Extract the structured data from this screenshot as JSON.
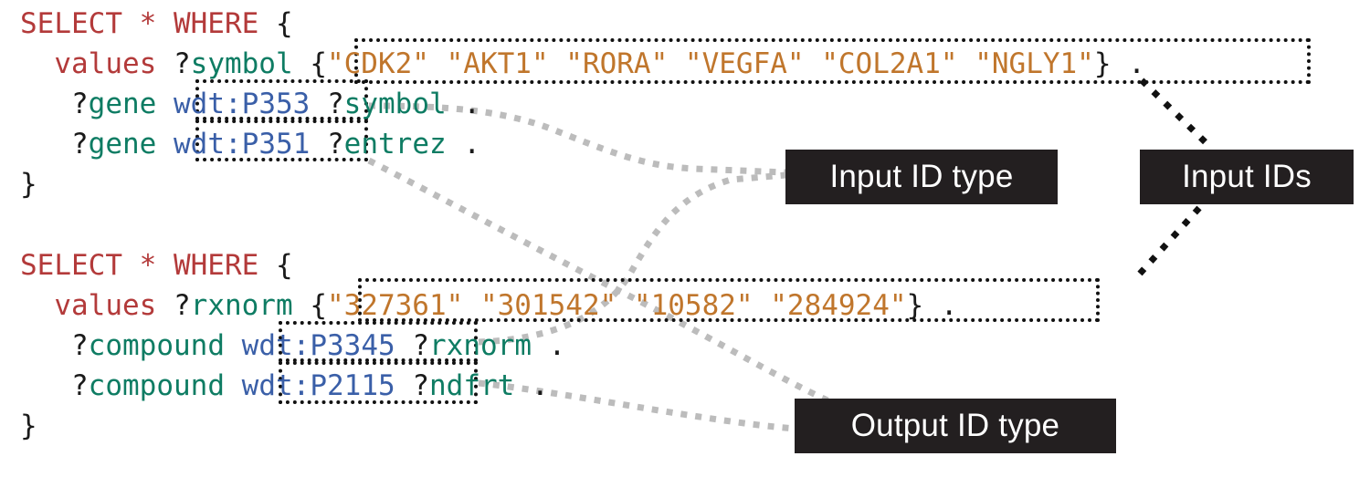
{
  "figure": {
    "title": "SPARQL query annotation diagram",
    "background_color": "#ffffff",
    "syntax_colors": {
      "keyword": "#b33a3a",
      "variable": "#0e7c63",
      "predicate": "#3a5fa8",
      "string": "#c0762c",
      "punctuation": "#1a1a1a",
      "label_background": "#231f20",
      "label_text": "#ffffff",
      "highlight_border": "#111111",
      "connector_gray": "#b8b8b8",
      "connector_black": "#111111"
    }
  },
  "queries": [
    {
      "id": "gene-query",
      "lines": [
        {
          "id": "q1l1",
          "tokens": [
            {
              "t": "SELECT * WHERE ",
              "c": "kw"
            },
            {
              "t": "{",
              "c": "pun"
            }
          ]
        },
        {
          "id": "q1l2",
          "tokens": [
            {
              "t": "  values ",
              "c": "kw"
            },
            {
              "t": "?",
              "c": "pun"
            },
            {
              "t": "symbol",
              "c": "var"
            },
            {
              "t": " ",
              "c": "pun"
            },
            {
              "t": "{",
              "c": "pun"
            },
            {
              "t": "\"CDK2\" \"AKT1\" \"RORA\" \"VEGFA\" \"COL2A1\" \"NGLY1\"",
              "c": "str"
            },
            {
              "t": "}",
              "c": "pun"
            },
            {
              "t": " .",
              "c": "pun"
            }
          ]
        },
        {
          "id": "q1l3",
          "tokens": [
            {
              "t": "   ",
              "c": "pun"
            },
            {
              "t": "?",
              "c": "pun"
            },
            {
              "t": "gene",
              "c": "var"
            },
            {
              "t": " ",
              "c": "pun"
            },
            {
              "t": "wdt",
              "c": "pred"
            },
            {
              "t": ":",
              "c": "pred"
            },
            {
              "t": "P353",
              "c": "pred"
            },
            {
              "t": " ",
              "c": "pun"
            },
            {
              "t": "?",
              "c": "pun"
            },
            {
              "t": "symbol",
              "c": "var"
            },
            {
              "t": " .",
              "c": "pun"
            }
          ]
        },
        {
          "id": "q1l4",
          "tokens": [
            {
              "t": "   ",
              "c": "pun"
            },
            {
              "t": "?",
              "c": "pun"
            },
            {
              "t": "gene",
              "c": "var"
            },
            {
              "t": " ",
              "c": "pun"
            },
            {
              "t": "wdt",
              "c": "pred"
            },
            {
              "t": ":",
              "c": "pred"
            },
            {
              "t": "P351",
              "c": "pred"
            },
            {
              "t": " ",
              "c": "pun"
            },
            {
              "t": "?",
              "c": "pun"
            },
            {
              "t": "entrez",
              "c": "var"
            },
            {
              "t": " .",
              "c": "pun"
            }
          ]
        },
        {
          "id": "q1l5",
          "tokens": [
            {
              "t": "}",
              "c": "pun"
            }
          ]
        }
      ]
    },
    {
      "id": "compound-query",
      "lines": [
        {
          "id": "q2l1",
          "tokens": [
            {
              "t": "SELECT * WHERE ",
              "c": "kw"
            },
            {
              "t": "{",
              "c": "pun"
            }
          ]
        },
        {
          "id": "q2l2",
          "tokens": [
            {
              "t": "  values ",
              "c": "kw"
            },
            {
              "t": "?",
              "c": "pun"
            },
            {
              "t": "rxnorm",
              "c": "var"
            },
            {
              "t": " ",
              "c": "pun"
            },
            {
              "t": "{",
              "c": "pun"
            },
            {
              "t": "\"327361\" \"301542\" \"10582\" \"284924\"",
              "c": "str"
            },
            {
              "t": "}",
              "c": "pun"
            },
            {
              "t": " .",
              "c": "pun"
            }
          ]
        },
        {
          "id": "q2l3",
          "tokens": [
            {
              "t": "   ",
              "c": "pun"
            },
            {
              "t": "?",
              "c": "pun"
            },
            {
              "t": "compound",
              "c": "var"
            },
            {
              "t": " ",
              "c": "pun"
            },
            {
              "t": "wdt",
              "c": "pred"
            },
            {
              "t": ":",
              "c": "pred"
            },
            {
              "t": "P3345",
              "c": "pred"
            },
            {
              "t": " ",
              "c": "pun"
            },
            {
              "t": "?",
              "c": "pun"
            },
            {
              "t": "rxnorm",
              "c": "var"
            },
            {
              "t": " .",
              "c": "pun"
            }
          ]
        },
        {
          "id": "q2l4",
          "tokens": [
            {
              "t": "   ",
              "c": "pun"
            },
            {
              "t": "?",
              "c": "pun"
            },
            {
              "t": "compound",
              "c": "var"
            },
            {
              "t": " ",
              "c": "pun"
            },
            {
              "t": "wdt",
              "c": "pred"
            },
            {
              "t": ":",
              "c": "pred"
            },
            {
              "t": "P2115",
              "c": "pred"
            },
            {
              "t": " ",
              "c": "pun"
            },
            {
              "t": "?",
              "c": "pun"
            },
            {
              "t": "ndfrt",
              "c": "var"
            },
            {
              "t": " .",
              "c": "pun"
            }
          ]
        },
        {
          "id": "q2l5",
          "tokens": [
            {
              "t": "}",
              "c": "pun"
            }
          ]
        }
      ]
    }
  ],
  "annotations": {
    "input_id_type": "Input ID type",
    "input_ids": "Input IDs",
    "output_id_type": "Output ID type"
  },
  "highlights": [
    {
      "name": "values-ids-gene",
      "label": "Input IDs"
    },
    {
      "name": "wdt-p353",
      "label": "Input ID type"
    },
    {
      "name": "wdt-p351",
      "label": "Output ID type"
    },
    {
      "name": "values-ids-compound",
      "label": "Input IDs"
    },
    {
      "name": "wdt-p3345",
      "label": "Input ID type"
    },
    {
      "name": "wdt-p2115",
      "label": "Output ID type"
    }
  ]
}
